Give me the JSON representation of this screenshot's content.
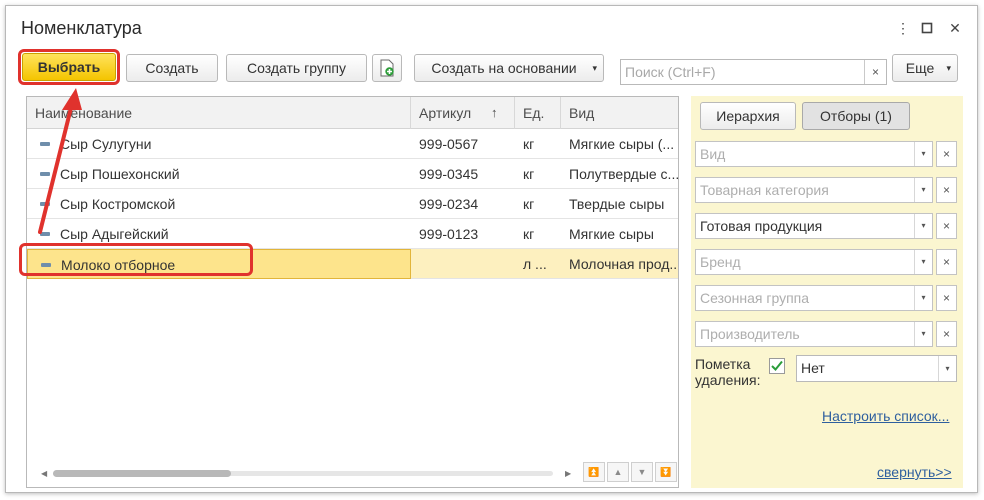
{
  "window": {
    "title": "Номенклатура",
    "menu_glyph": "⋮",
    "restore_glyph": "☐",
    "close_glyph": "✕"
  },
  "toolbar": {
    "select_label": "Выбрать",
    "create_label": "Создать",
    "create_group_label": "Создать группу",
    "create_based_label": "Создать на основании",
    "more_label": "Еще",
    "dropdown_glyph": "▾",
    "doc_icon": "add-document-icon"
  },
  "search": {
    "placeholder": "Поиск (Ctrl+F)",
    "clear_glyph": "×"
  },
  "table": {
    "columns": [
      "Наименование",
      "Артикул",
      "Ед.",
      "Вид"
    ],
    "sort_glyph": "↑",
    "rows": [
      {
        "name": "Сыр Сулугуни",
        "article": "999-0567",
        "unit": "кг",
        "kind": "Мягкие сыры (..."
      },
      {
        "name": "Сыр Пошехонский",
        "article": "999-0345",
        "unit": "кг",
        "kind": "Полутвердые с..."
      },
      {
        "name": "Сыр Костромской",
        "article": "999-0234",
        "unit": "кг",
        "kind": "Твердые сыры"
      },
      {
        "name": "Сыр Адыгейский",
        "article": "999-0123",
        "unit": "кг",
        "kind": "Мягкие сыры"
      },
      {
        "name": "Молоко отборное",
        "article": "",
        "unit": "л ...",
        "kind": "Молочная прод..."
      }
    ],
    "selected_row": 4,
    "scroll_left_glyph": "◀",
    "scroll_right_glyph": "▶",
    "nav_glyphs": [
      "⏫",
      "▲",
      "▼",
      "⏬"
    ]
  },
  "panel": {
    "hierarchy_label": "Иерархия",
    "filters_label": "Отборы (1)",
    "filters": [
      {
        "placeholder": "Вид",
        "value": ""
      },
      {
        "placeholder": "Товарная категория",
        "value": ""
      },
      {
        "placeholder": "",
        "value": "Готовая продукция"
      },
      {
        "placeholder": "Бренд",
        "value": ""
      },
      {
        "placeholder": "Сезонная группа",
        "value": ""
      },
      {
        "placeholder": "Производитель",
        "value": ""
      }
    ],
    "dropdown_glyph": "▾",
    "clear_glyph": "×",
    "deletion_mark_label_line1": "Пометка",
    "deletion_mark_label_line2": "удаления:",
    "deletion_mark_checked": true,
    "deletion_mark_value": "Нет",
    "configure_link": "Настроить список...",
    "collapse_link": "свернуть>>"
  },
  "colors": {
    "primary_button": "#f4c400",
    "highlight_red": "#e0322d",
    "selected_row": "#fde48c",
    "panel_bg": "#fbf6d0",
    "link": "#2e5f9e",
    "checkmark": "#2a9d3a"
  }
}
